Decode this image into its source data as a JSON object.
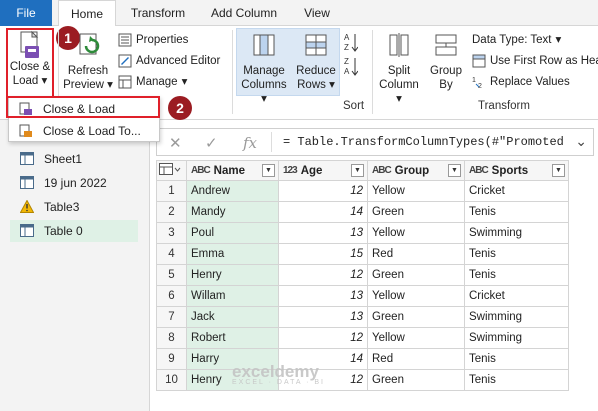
{
  "tabs": {
    "file": "File",
    "home": "Home",
    "transform": "Transform",
    "add_column": "Add Column",
    "view": "View"
  },
  "ribbon": {
    "close_load": "Close &",
    "close_load2": "Load",
    "refresh": "Refresh",
    "refresh2": "Preview",
    "properties": "Properties",
    "advanced_editor": "Advanced Editor",
    "manage": "Manage",
    "manage_columns": "Manage",
    "manage_columns2": "Columns",
    "reduce_rows": "Reduce",
    "reduce_rows2": "Rows",
    "sort_label": "Sort",
    "split_column": "Split",
    "split_column2": "Column",
    "group_by": "Group",
    "group_by2": "By",
    "data_type": "Data Type: Text",
    "use_first_row": "Use First Row as Hea",
    "replace_values": "Replace Values",
    "transform_label": "Transform"
  },
  "menu": {
    "item1": "Close & Load",
    "item2": "Close & Load To..."
  },
  "badges": {
    "one": "1",
    "two": "2"
  },
  "queries": [
    "Sheet1",
    "19 jun 2022",
    "Table3",
    "Table 0"
  ],
  "formula": "= Table.TransformColumnTypes(#\"Promoted",
  "columns": [
    {
      "type": "ABC",
      "name": "Name"
    },
    {
      "type": "123",
      "name": "Age"
    },
    {
      "type": "ABC",
      "name": "Group"
    },
    {
      "type": "ABC",
      "name": "Sports"
    }
  ],
  "rows": [
    [
      "1",
      "Andrew",
      "12",
      "Yellow",
      "Cricket"
    ],
    [
      "2",
      "Mandy",
      "14",
      "Green",
      "Tenis"
    ],
    [
      "3",
      "Poul",
      "13",
      "Yellow",
      "Swimming"
    ],
    [
      "4",
      "Emma",
      "15",
      "Red",
      "Tenis"
    ],
    [
      "5",
      "Henry",
      "12",
      "Green",
      "Tenis"
    ],
    [
      "6",
      "Willam",
      "13",
      "Yellow",
      "Cricket"
    ],
    [
      "7",
      "Jack",
      "13",
      "Green",
      "Swimming"
    ],
    [
      "8",
      "Robert",
      "12",
      "Yellow",
      "Swimming"
    ],
    [
      "9",
      "Harry",
      "14",
      "Red",
      "Tenis"
    ],
    [
      "10",
      "Henry",
      "12",
      "Green",
      "Tenis"
    ]
  ],
  "watermark": {
    "brand": "exceldemy",
    "tagline": "EXCEL · DATA · BI"
  },
  "colors": {
    "file_tab": "#1f6fbf",
    "marker": "#e0202a",
    "badge": "#9b1c22",
    "selected": "#dff1e6"
  }
}
